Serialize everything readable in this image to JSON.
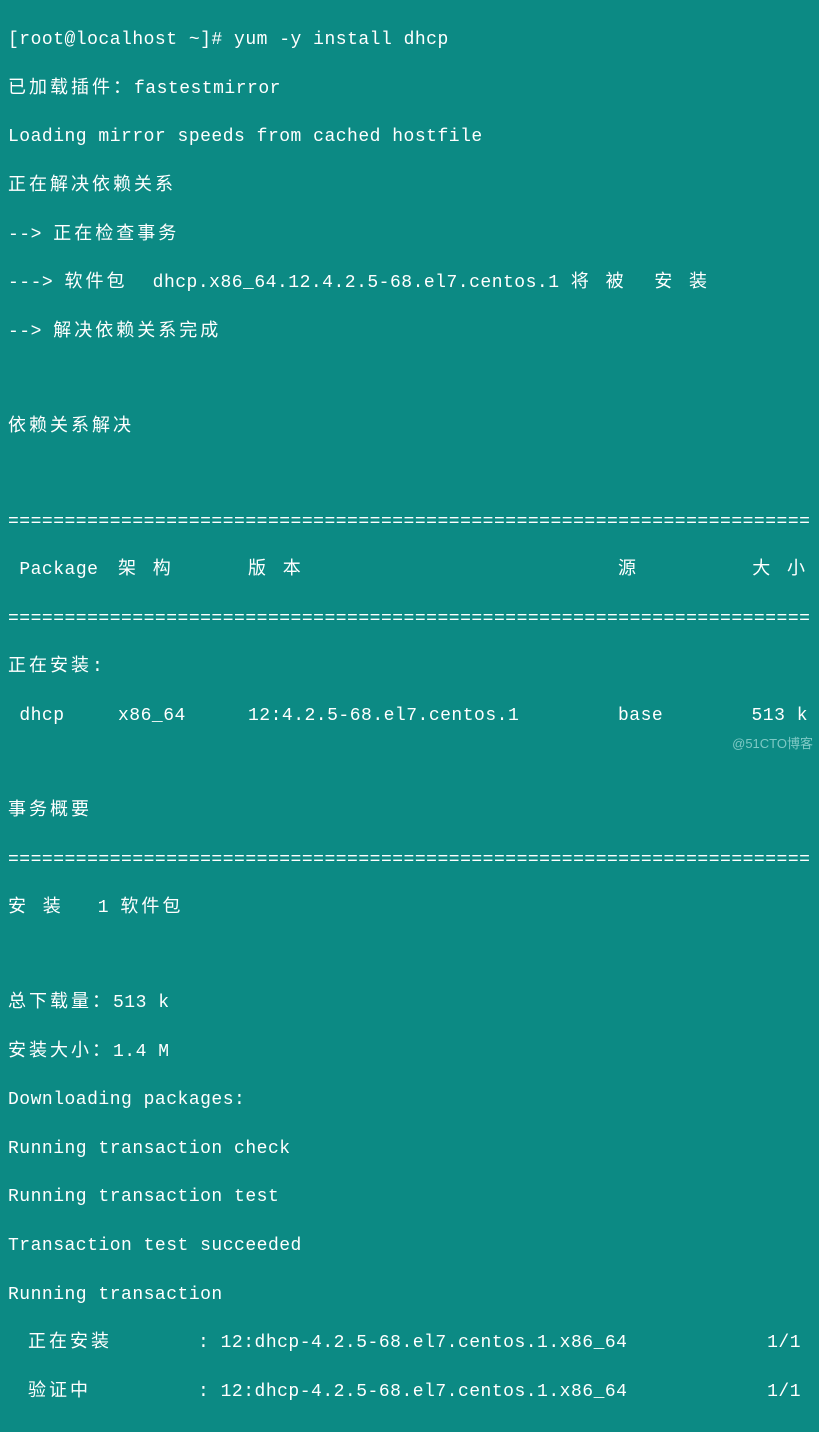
{
  "prompt": {
    "user_host": "[root@localhost ~]#",
    "command": "yum -y install dhcp"
  },
  "lines": {
    "loaded_plugins_label": "已加载插件：",
    "loaded_plugins_value": "fastestmirror",
    "loading_mirror": "Loading mirror speeds from cached hostfile",
    "resolve_deps": "正在解决依赖关系",
    "check_trans": "--> 正在检查事务",
    "pkg_finding_prefix": "---> 软件包",
    "pkg_finding_name": "dhcp.x86_64.12.4.2.5-68.el7.centos.1",
    "pkg_finding_suffix": "将 被  安 装",
    "deps_done": "--> 解决依赖关系完成",
    "deps_resolved": "依赖关系解决"
  },
  "table": {
    "headers": {
      "package": "Package",
      "arch": "架 构",
      "version": "版 本",
      "repo": "源",
      "size": "大 小"
    },
    "installing_label": "正在安装:",
    "row": {
      "name": "dhcp",
      "arch": "x86_64",
      "version": "12:4.2.5-68.el7.centos.1",
      "repo": "base",
      "size": "513 k"
    }
  },
  "summary": {
    "heading": "事务概要",
    "install_label": "安 装",
    "install_count": "1",
    "install_suffix": "软件包",
    "total_dl_label": "总下载量：",
    "total_dl_value": "513 k",
    "install_size_label": "安装大小：",
    "install_size_value": "1.4 M"
  },
  "progress": {
    "downloading": "Downloading packages:",
    "check": "Running transaction check",
    "test": "Running transaction test",
    "succeeded": "Transaction test succeeded",
    "running": "Running transaction",
    "installing_label": "正在安装",
    "verifying_label": "验证中",
    "pkg": "12:dhcp-4.2.5-68.el7.centos.1.x86_64",
    "count": "1/1"
  },
  "divider": "================================================================================",
  "watermark": "@51CTO博客"
}
